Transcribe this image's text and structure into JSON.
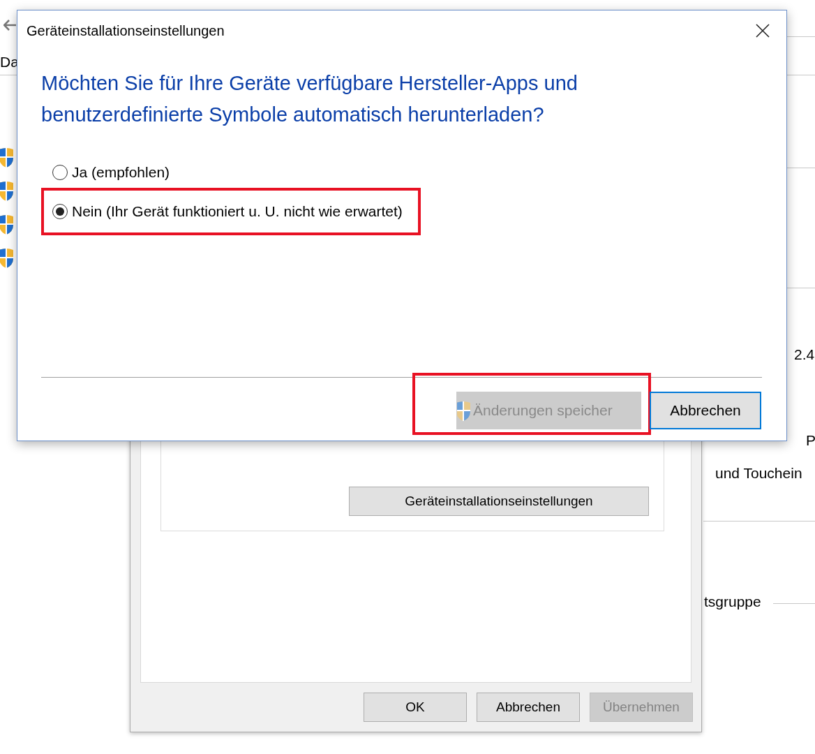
{
  "background_window": {
    "tab_fragment": "Da",
    "shield_count_items": [
      {
        "kind": "shield"
      },
      {
        "kind": "shield"
      },
      {
        "kind": "shield"
      },
      {
        "kind": "shield"
      }
    ],
    "value_fragments": [
      {
        "text": "2.4"
      },
      {
        "text": "P"
      },
      {
        "text": "und Touchein"
      },
      {
        "text": "tsgruppe"
      }
    ]
  },
  "system_properties": {
    "settings_button": "Geräteinstallationseinstellungen",
    "buttons": [
      {
        "label": "OK",
        "disabled": false
      },
      {
        "label": "Abbrechen",
        "disabled": false
      },
      {
        "label": "Übernehmen",
        "disabled": true
      }
    ]
  },
  "dialog": {
    "title": "Geräteinstallationseinstellungen",
    "question": "Möchten Sie für Ihre Geräte verfügbare Hersteller-Apps und benutzerdefinierte Symbole automatisch herunterladen?",
    "options": [
      {
        "label": "Ja (empfohlen)",
        "selected": false,
        "highlighted": false
      },
      {
        "label": "Nein (Ihr Gerät funktioniert u. U. nicht wie erwartet)",
        "selected": true,
        "highlighted": true
      }
    ],
    "buttons": [
      {
        "label": "Änderungen speicher",
        "disabled": true,
        "shield": true,
        "highlighted": true,
        "default": false
      },
      {
        "label": "Abbrechen",
        "disabled": false,
        "shield": false,
        "highlighted": false,
        "default": true
      }
    ]
  }
}
